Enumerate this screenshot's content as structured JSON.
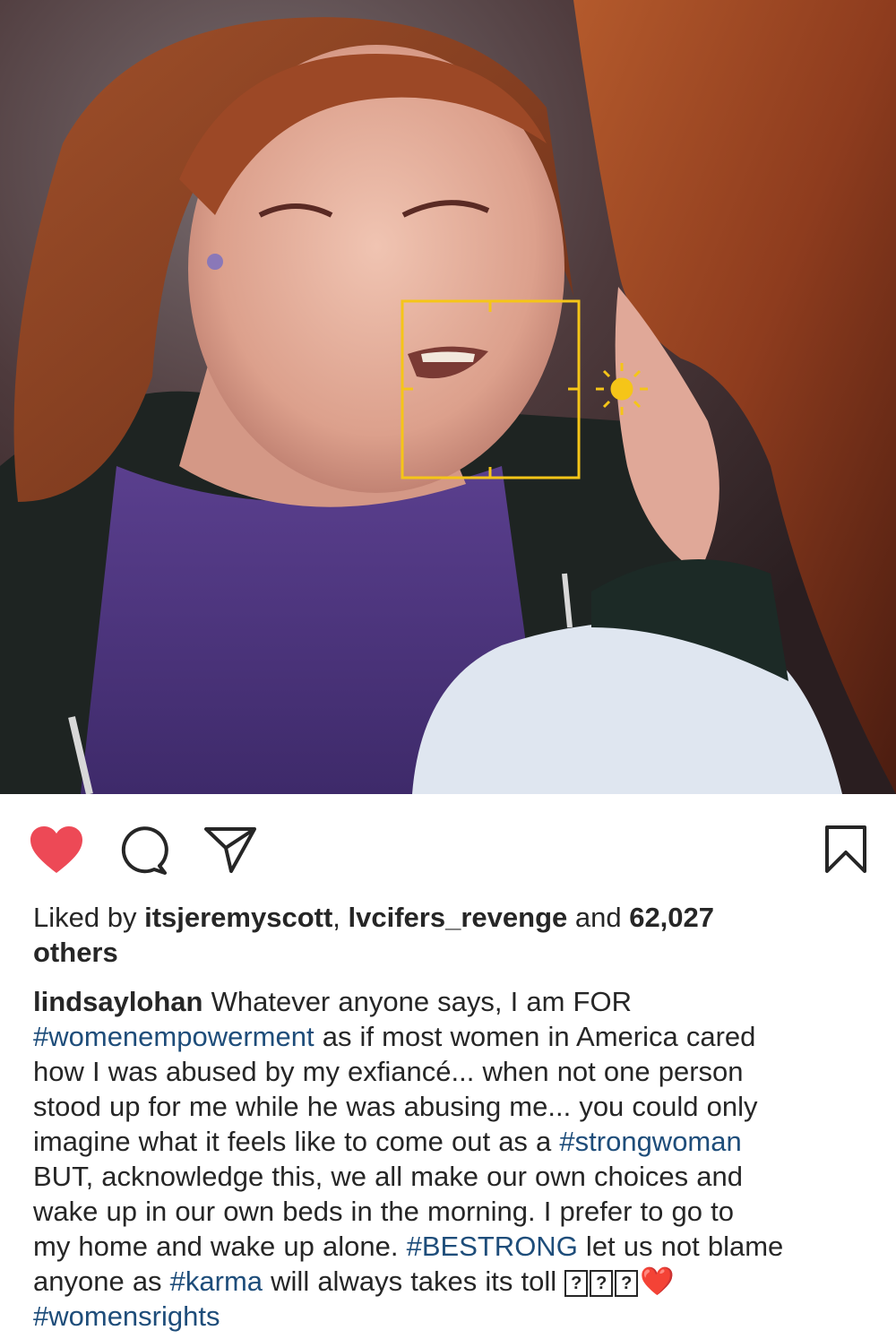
{
  "post": {
    "photo_alt": "",
    "focus_box_color": "#f5c518"
  },
  "actions": {
    "like_icon": "heart-filled-icon",
    "comment_icon": "comment-icon",
    "share_icon": "paper-plane-icon",
    "save_icon": "bookmark-icon",
    "like_color": "#ed4956"
  },
  "likes": {
    "prefix": "Liked by ",
    "user1": "itsjeremyscott",
    "sep": ", ",
    "user2": "lvcifers_revenge",
    "and": " and ",
    "count": "62,027",
    "others": "others"
  },
  "caption": {
    "username": "lindsaylohan",
    "l1_text": " Whatever anyone says, I am FOR",
    "l2_tag": "#womenempowerment",
    "l2_text": " as if most women in America cared",
    "l3": "how I was abused by my exfiancé... when not one person",
    "l4": "stood up for me while he was abusing me... you could only",
    "l5_text": "imagine what it feels like to come out as a ",
    "l5_tag": "#strongwoman",
    "l6": "BUT, acknowledge this, we all make our own choices and",
    "l7": "wake up in our own beds in the morning. I prefer to go to",
    "l8_text": "my home and wake up alone. ",
    "l8_tag": "#BESTRONG",
    "l8_text2": " let us not blame",
    "l9_text": "anyone as ",
    "l9_tag": "#karma",
    "l9_text2": " will always takes its toll ",
    "l9_box": "?",
    "l9_heart": "❤️",
    "l10_tag": "#womensrights"
  }
}
